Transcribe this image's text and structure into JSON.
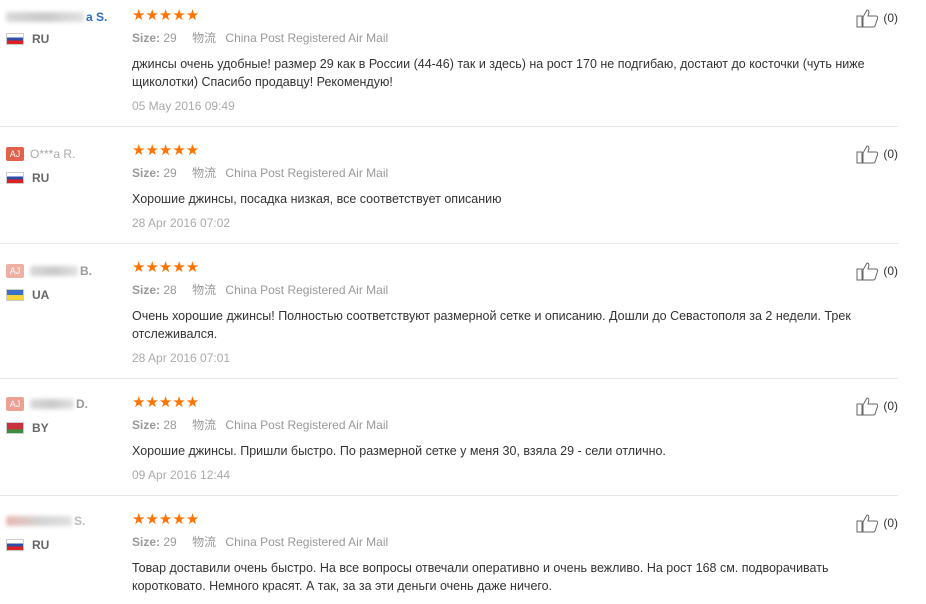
{
  "reviews": [
    {
      "avatar": "",
      "name": "a S.",
      "country": "RU",
      "stars": "★★★★★",
      "size_label": "Size:",
      "size_value": "29",
      "ship_label": "物流",
      "shipping": "China Post Registered Air Mail",
      "text": "джинсы очень удобные! размер 29 как в России (44-46) так и здесь) на рост 170 не подгибаю, достают до косточки (чуть ниже щиколотки) Спасибо продавцу! Рекомендую!",
      "date": "05 May 2016 09:49",
      "helpful": "(0)"
    },
    {
      "avatar": "AJ",
      "name": "O***a R.",
      "country": "RU",
      "stars": "★★★★★",
      "size_label": "Size:",
      "size_value": "29",
      "ship_label": "物流",
      "shipping": "China Post Registered Air Mail",
      "text": "Хорошие джинсы, посадка низкая, все соответствует описанию",
      "date": "28 Apr 2016 07:02",
      "helpful": "(0)"
    },
    {
      "avatar": "AJ",
      "name": "B.",
      "country": "UA",
      "stars": "★★★★★",
      "size_label": "Size:",
      "size_value": "28",
      "ship_label": "物流",
      "shipping": "China Post Registered Air Mail",
      "text": "Очень хорошие джинсы! Полностью соответствуют размерной сетке и описанию. Дошли до Севастополя за 2 недели. Трек отслеживался.",
      "date": "28 Apr 2016 07:01",
      "helpful": "(0)"
    },
    {
      "avatar": "AJ",
      "name": "D.",
      "country": "BY",
      "stars": "★★★★★",
      "size_label": "Size:",
      "size_value": "28",
      "ship_label": "物流",
      "shipping": "China Post Registered Air Mail",
      "text": "Хорошие джинсы. Пришли быстро. По размерной сетке у меня 30, взяла 29 - сели отлично.",
      "date": "09 Apr 2016 12:44",
      "helpful": "(0)"
    },
    {
      "avatar": "",
      "name": "S.",
      "country": "RU",
      "stars": "★★★★★",
      "size_label": "Size:",
      "size_value": "29",
      "ship_label": "物流",
      "shipping": "China Post Registered Air Mail",
      "text": "Товар доставили очень быстро. На все вопросы отвечали оперативно и очень вежливо. На рост 168 см. подворачивать коротковато. Немного красят. А так, за за эти деньги очень даже ничего.",
      "date": "",
      "helpful": "(0)"
    }
  ]
}
